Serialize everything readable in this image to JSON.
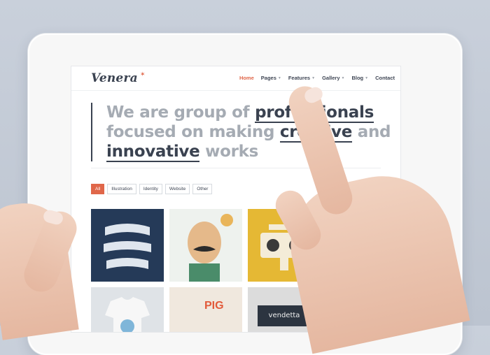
{
  "brand": {
    "logo": "Venera",
    "accent": "#e0674a",
    "dark": "#3a4250"
  },
  "nav": {
    "items": [
      {
        "label": "Home",
        "active": true,
        "dropdown": false
      },
      {
        "label": "Pages",
        "active": false,
        "dropdown": true
      },
      {
        "label": "Features",
        "active": false,
        "dropdown": true
      },
      {
        "label": "Gallery",
        "active": false,
        "dropdown": true
      },
      {
        "label": "Blog",
        "active": false,
        "dropdown": true
      },
      {
        "label": "Contact",
        "active": false,
        "dropdown": false
      }
    ]
  },
  "hero": {
    "line1_a": "We are group of ",
    "line1_b": "professionals",
    "line2_a": "focused on making ",
    "line2_b": "creative",
    "line2_c": " and",
    "line3_a": "innovative",
    "line3_b": " works"
  },
  "filters": [
    {
      "label": "All",
      "active": true
    },
    {
      "label": "Illustration",
      "active": false
    },
    {
      "label": "Identity",
      "active": false
    },
    {
      "label": "Website",
      "active": false
    },
    {
      "label": "Other",
      "active": false
    }
  ],
  "portfolio": {
    "vendetta_label": "vendetta",
    "pig_label": "PIG"
  }
}
